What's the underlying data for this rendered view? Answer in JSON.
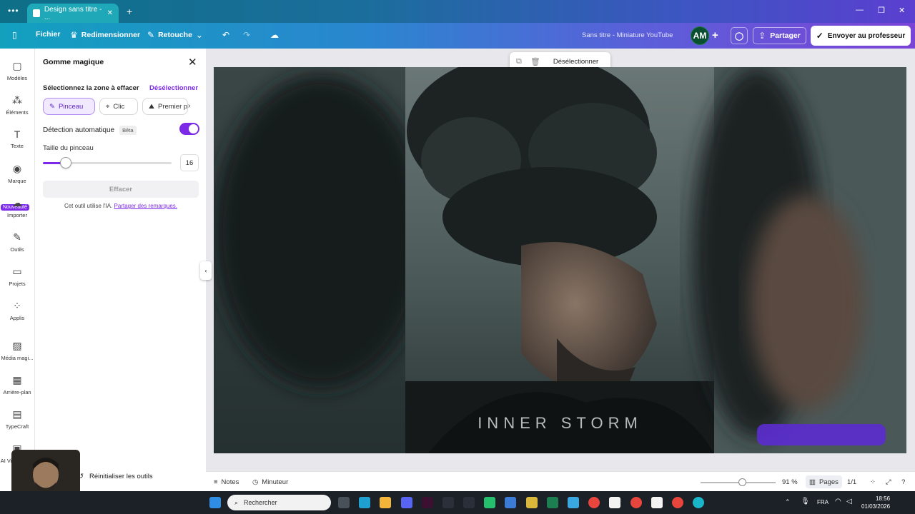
{
  "browser": {
    "tab_title": "Design sans titre - ...",
    "new_tab": "+",
    "menu": "•••"
  },
  "toolbar": {
    "file": "Fichier",
    "resize": "Redimensionner",
    "retouch": "Retouche",
    "doc_title": "Sans titre - Miniature YouTube",
    "avatar_initials": "AM",
    "share": "Partager",
    "send": "Envoyer au professeur"
  },
  "nav": {
    "items": [
      {
        "label": "Modèles",
        "icon": "templates-icon"
      },
      {
        "label": "Éléments",
        "icon": "elements-icon"
      },
      {
        "label": "Texte",
        "icon": "text-icon"
      },
      {
        "label": "Marque",
        "icon": "brand-icon"
      },
      {
        "label": "Importer",
        "icon": "upload-icon"
      },
      {
        "label": "Outils",
        "icon": "tools-icon"
      },
      {
        "label": "Projets",
        "icon": "folder-icon"
      },
      {
        "label": "Applis",
        "icon": "apps-icon"
      },
      {
        "label": "Média magi...",
        "icon": "magic-media-icon"
      },
      {
        "label": "Arrière-plan",
        "icon": "background-icon"
      },
      {
        "label": "TypeCraft",
        "icon": "typecraft-icon"
      },
      {
        "label": "AI Video Ge...",
        "icon": "ai-video-icon"
      }
    ],
    "new_badge": "Nouveauté"
  },
  "panel": {
    "title": "Gomme magique",
    "select_zone": "Sélectionnez la zone à effacer",
    "deselect": "Désélectionner",
    "modes": [
      "Pinceau",
      "Clic",
      "Premier p"
    ],
    "auto_detect": "Détection automatique",
    "beta": "Bêta",
    "brush_size_label": "Taille du pinceau",
    "brush_size_value": "16",
    "brush_size_fraction": 0.18,
    "erase_button": "Effacer",
    "ai_note": "Cet outil utilise l'IA.",
    "ai_link": "Partager des remarques.",
    "reset_tools": "Réinitialiser les outils"
  },
  "canvas": {
    "floating_deselect": "Désélectionner",
    "headline": "INNER STORM"
  },
  "statusbar": {
    "notes": "Notes",
    "timer": "Minuteur",
    "zoom": "91 %",
    "zoom_fraction": 0.55,
    "pages": "Pages",
    "page_count": "1/1"
  },
  "taskbar": {
    "search_placeholder": "Rechercher",
    "lang": "FRA",
    "time": "18:56",
    "date": "01/03/2026"
  },
  "colors": {
    "accent": "#7d2ae8",
    "canvas_bg": "#2f3636"
  }
}
